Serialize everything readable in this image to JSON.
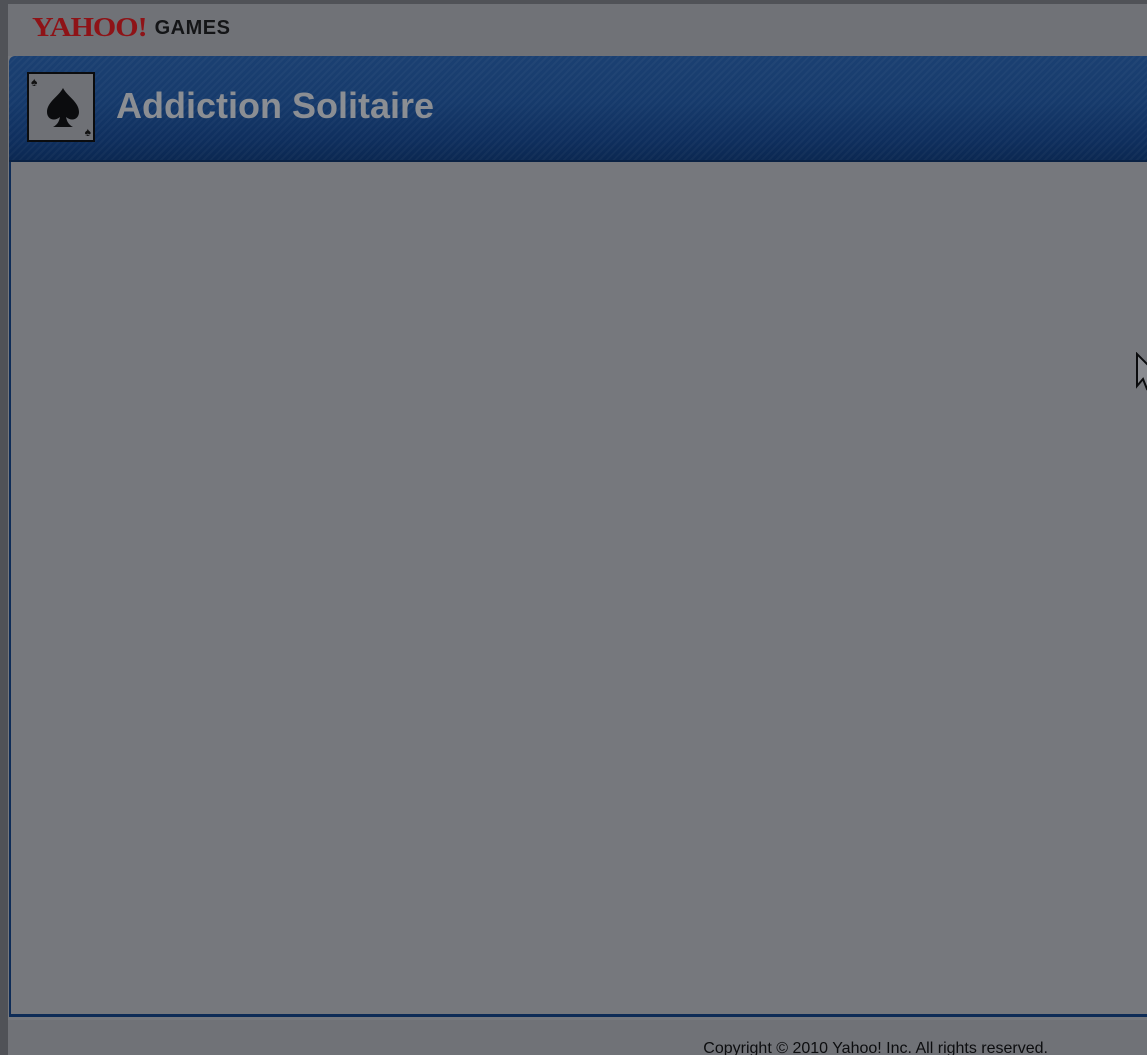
{
  "header": {
    "brand_name": "YAHOO!",
    "brand_section": "GAMES",
    "brand_color": "#8e1317"
  },
  "game": {
    "title": "Addiction Solitaire",
    "icon": "spade-card-icon",
    "banner_color": "#163a6b"
  },
  "footer": {
    "copyright": "Copyright © 2010 Yahoo! Inc. All rights reserved."
  },
  "cursor": {
    "icon": "mouse-pointer-icon"
  }
}
